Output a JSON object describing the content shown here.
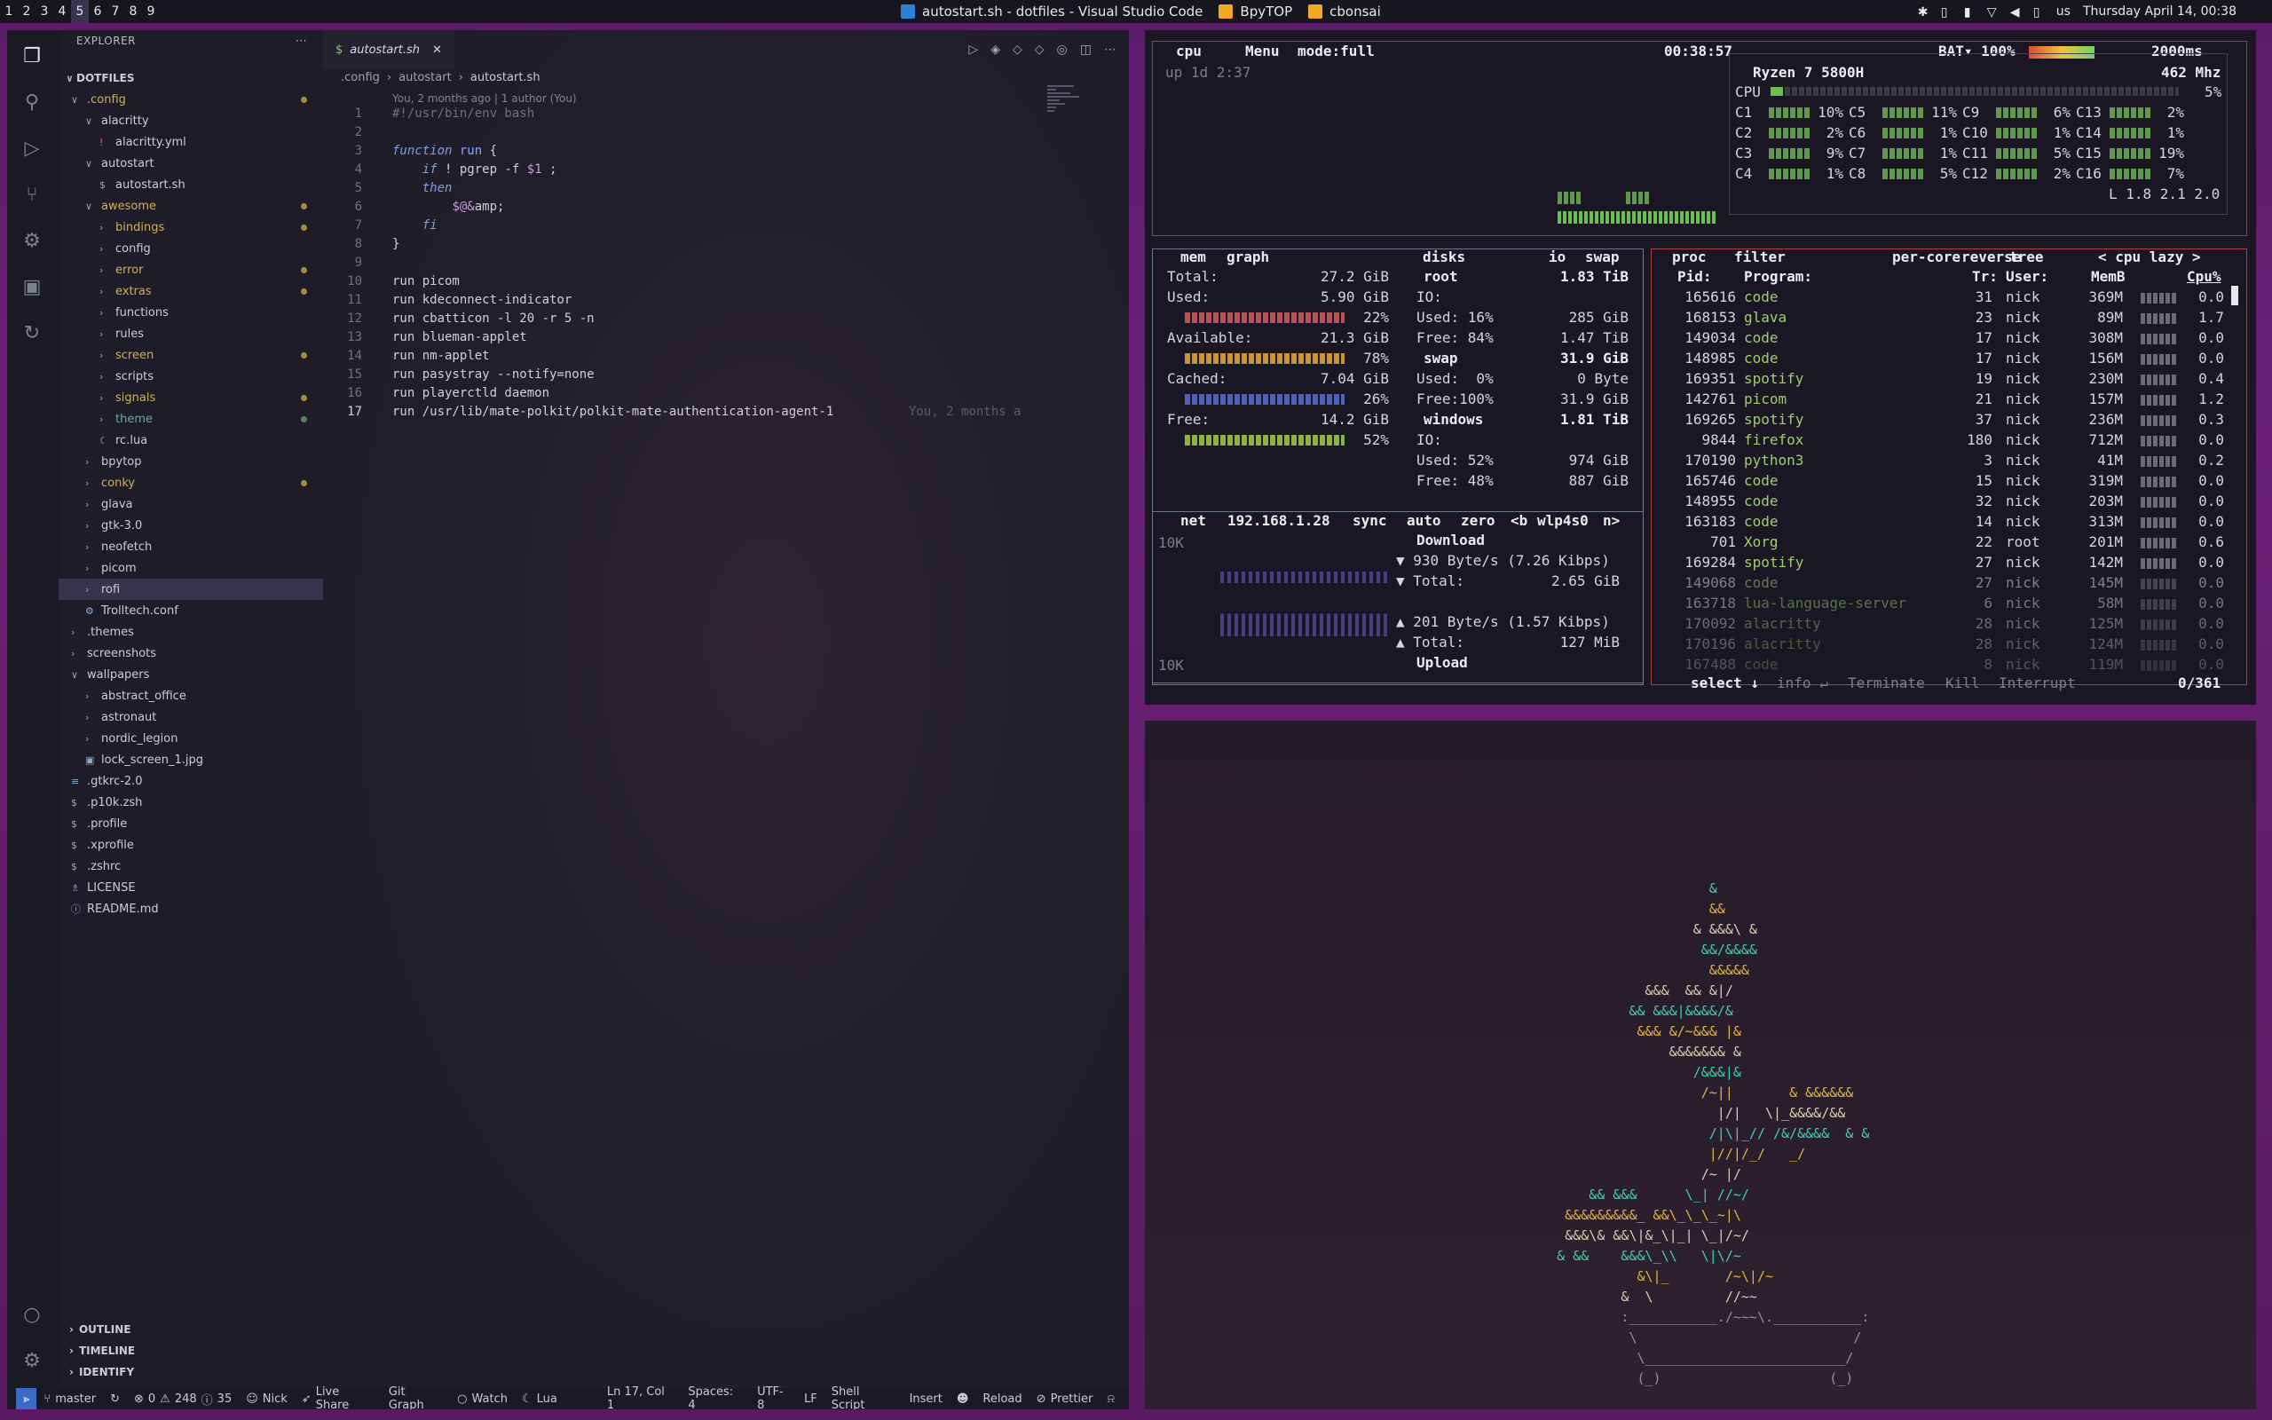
{
  "topbar": {
    "workspaces": [
      "1",
      "2",
      "3",
      "4",
      "5",
      "6",
      "7",
      "8",
      "9"
    ],
    "active_workspace": "5",
    "windows": [
      {
        "title": "autostart.sh - dotfiles - Visual Studio Code",
        "icon": "vscode-icon"
      },
      {
        "title": "BpyTOP",
        "icon": "terminal-icon"
      },
      {
        "title": "cbonsai",
        "icon": "terminal-icon"
      }
    ],
    "keyboard_layout": "us",
    "datetime": "Thursday April 14, 00:38"
  },
  "vscode": {
    "explorer_title": "EXPLORER",
    "more_actions": "···",
    "root": "DOTFILES",
    "tree": [
      {
        "label": ".config",
        "depth": 0,
        "type": "folder-open",
        "color": "#d5b04a",
        "dot": "yellow"
      },
      {
        "label": "alacritty",
        "depth": 1,
        "type": "folder-open",
        "color": "#c9cdd6"
      },
      {
        "label": "alacritty.yml",
        "depth": 2,
        "type": "file",
        "icon": "!",
        "color": "#c9cdd6"
      },
      {
        "label": "autostart",
        "depth": 1,
        "type": "folder-open",
        "color": "#c9cdd6"
      },
      {
        "label": "autostart.sh",
        "depth": 2,
        "type": "file",
        "icon": "$",
        "color": "#c9cdd6"
      },
      {
        "label": "awesome",
        "depth": 1,
        "type": "folder-open",
        "color": "#d5b04a",
        "dot": "yellow"
      },
      {
        "label": "bindings",
        "depth": 2,
        "type": "folder",
        "color": "#d5b04a",
        "dot": "yellow"
      },
      {
        "label": "config",
        "depth": 2,
        "type": "folder",
        "color": "#c9cdd6"
      },
      {
        "label": "error",
        "depth": 2,
        "type": "folder",
        "color": "#d5b04a",
        "dot": "yellow"
      },
      {
        "label": "extras",
        "depth": 2,
        "type": "folder",
        "color": "#d5b04a",
        "dot": "yellow"
      },
      {
        "label": "functions",
        "depth": 2,
        "type": "folder",
        "color": "#c9cdd6"
      },
      {
        "label": "rules",
        "depth": 2,
        "type": "folder",
        "color": "#c9cdd6"
      },
      {
        "label": "screen",
        "depth": 2,
        "type": "folder",
        "color": "#d5b04a",
        "dot": "yellow"
      },
      {
        "label": "scripts",
        "depth": 2,
        "type": "folder",
        "color": "#c9cdd6"
      },
      {
        "label": "signals",
        "depth": 2,
        "type": "folder",
        "color": "#d5b04a",
        "dot": "yellow"
      },
      {
        "label": "theme",
        "depth": 2,
        "type": "folder",
        "color": "#5eb2a0",
        "dot": "green"
      },
      {
        "label": "rc.lua",
        "depth": 2,
        "type": "file",
        "icon": "☾",
        "color": "#c9cdd6"
      },
      {
        "label": "bpytop",
        "depth": 1,
        "type": "folder",
        "color": "#c9cdd6"
      },
      {
        "label": "conky",
        "depth": 1,
        "type": "folder",
        "color": "#d5b04a",
        "dot": "yellow"
      },
      {
        "label": "glava",
        "depth": 1,
        "type": "folder",
        "color": "#c9cdd6"
      },
      {
        "label": "gtk-3.0",
        "depth": 1,
        "type": "folder",
        "color": "#c9cdd6"
      },
      {
        "label": "neofetch",
        "depth": 1,
        "type": "folder",
        "color": "#c9cdd6"
      },
      {
        "label": "picom",
        "depth": 1,
        "type": "folder",
        "color": "#c9cdd6"
      },
      {
        "label": "rofi",
        "depth": 1,
        "type": "folder",
        "color": "#c9cdd6",
        "selected": true
      },
      {
        "label": "Trolltech.conf",
        "depth": 1,
        "type": "file",
        "icon": "⚙",
        "color": "#c9cdd6"
      },
      {
        "label": ".themes",
        "depth": 0,
        "type": "folder",
        "color": "#c9cdd6"
      },
      {
        "label": "screenshots",
        "depth": 0,
        "type": "folder",
        "color": "#c9cdd6"
      },
      {
        "label": "wallpapers",
        "depth": 0,
        "type": "folder-open",
        "color": "#c9cdd6"
      },
      {
        "label": "abstract_office",
        "depth": 1,
        "type": "folder",
        "color": "#c9cdd6"
      },
      {
        "label": "astronaut",
        "depth": 1,
        "type": "folder",
        "color": "#c9cdd6"
      },
      {
        "label": "nordic_legion",
        "depth": 1,
        "type": "folder",
        "color": "#c9cdd6"
      },
      {
        "label": "lock_screen_1.jpg",
        "depth": 1,
        "type": "file",
        "icon": "▣",
        "color": "#c9cdd6"
      },
      {
        "label": ".gtkrc-2.0",
        "depth": 0,
        "type": "file",
        "icon": "≡",
        "color": "#c9cdd6"
      },
      {
        "label": ".p10k.zsh",
        "depth": 0,
        "type": "file",
        "icon": "$",
        "color": "#c9cdd6"
      },
      {
        "label": ".profile",
        "depth": 0,
        "type": "file",
        "icon": "$",
        "color": "#c9cdd6"
      },
      {
        "label": ".xprofile",
        "depth": 0,
        "type": "file",
        "icon": "$",
        "color": "#c9cdd6"
      },
      {
        "label": ".zshrc",
        "depth": 0,
        "type": "file",
        "icon": "$",
        "color": "#c9cdd6"
      },
      {
        "label": "LICENSE",
        "depth": 0,
        "type": "file",
        "icon": "♗",
        "color": "#c9cdd6"
      },
      {
        "label": "README.md",
        "depth": 0,
        "type": "file",
        "icon": "ⓘ",
        "color": "#c9cdd6"
      }
    ],
    "sections": [
      "OUTLINE",
      "TIMELINE",
      "IDENTIFY"
    ],
    "tab": {
      "label": "autostart.sh",
      "icon": "$"
    },
    "breadcrumb": [
      ".config",
      "autostart",
      "autostart.sh"
    ],
    "blame_header": "You, 2 months ago | 1 author (You)",
    "code": [
      "#!/usr/bin/env bash",
      "",
      "function run {",
      "    if ! pgrep -f $1 ;",
      "    then",
      "        $@&",
      "    fi",
      "}",
      "",
      "run picom",
      "run kdeconnect-indicator",
      "run cbatticon -l 20 -r 5 -n",
      "run blueman-applet",
      "run nm-applet",
      "run pasystray --notify=none",
      "run playerctld daemon",
      "run /usr/lib/mate-polkit/polkit-mate-authentication-agent-1"
    ],
    "inline_blame": "You, 2 months a",
    "current_line": 17,
    "status": {
      "branch": "master",
      "errors": "0",
      "warnings": "248",
      "info": "35",
      "user": "Nick",
      "live_share": "Live Share",
      "git_graph": "Git Graph",
      "watch": "Watch",
      "lua": "Lua",
      "position": "Ln 17, Col 1",
      "spaces": "Spaces: 4",
      "encoding": "UTF-8",
      "eol": "LF",
      "language": "Shell Script",
      "mode": "Insert",
      "reload": "Reload",
      "prettier": "Prettier"
    }
  },
  "bpytop": {
    "cpu_box": {
      "label": "cpu",
      "menu": "Menu",
      "mode": "mode:full",
      "clock": "00:38:57",
      "battery": "BAT▾ 100%",
      "interval": "2000ms",
      "uptime": "up 1d 2:37"
    },
    "cpu_info": {
      "model": "Ryzen 7 5800H",
      "freq": "462 Mhz",
      "total": "5%",
      "cores": [
        [
          "C1",
          "10%"
        ],
        [
          "C5",
          "11%"
        ],
        [
          "C9",
          "6%"
        ],
        [
          "C13",
          "2%"
        ],
        [
          "C2",
          "2%"
        ],
        [
          "C6",
          "1%"
        ],
        [
          "C10",
          "1%"
        ],
        [
          "C14",
          "1%"
        ],
        [
          "C3",
          "9%"
        ],
        [
          "C7",
          "1%"
        ],
        [
          "C11",
          "5%"
        ],
        [
          "C15",
          "19%"
        ],
        [
          "C4",
          "1%"
        ],
        [
          "C8",
          "5%"
        ],
        [
          "C12",
          "2%"
        ],
        [
          "C16",
          "7%"
        ]
      ],
      "load": "L 1.8 2.1 2.0"
    },
    "mem": {
      "tabs": [
        "mem",
        "graph"
      ],
      "rows": [
        [
          "Total:",
          "27.2 GiB"
        ],
        [
          "Used:",
          "5.90 GiB"
        ],
        [
          "",
          "22%"
        ],
        [
          "Available:",
          "21.3 GiB"
        ],
        [
          "",
          "78%"
        ],
        [
          "Cached:",
          "7.04 GiB"
        ],
        [
          "",
          "26%"
        ],
        [
          "Free:",
          "14.2 GiB"
        ],
        [
          "",
          "52%"
        ]
      ]
    },
    "disks": {
      "tabs": [
        "disks",
        "io",
        "swap"
      ],
      "rows": [
        [
          "root",
          "1.83 TiB",
          true
        ],
        [
          "IO:",
          "",
          false
        ],
        [
          "Used: 16%",
          "285 GiB",
          false
        ],
        [
          "Free: 84%",
          "1.47 TiB",
          false
        ],
        [
          "swap",
          "31.9 GiB",
          true
        ],
        [
          "Used:  0%",
          "0 Byte",
          false
        ],
        [
          "Free:100%",
          "31.9 GiB",
          false
        ],
        [
          "windows",
          "1.81 TiB",
          true
        ],
        [
          "IO:",
          "",
          false
        ],
        [
          "Used: 52%",
          "974 GiB",
          false
        ],
        [
          "Free: 48%",
          "887 GiB",
          false
        ]
      ]
    },
    "net": {
      "label": "net",
      "ip": "192.168.1.28",
      "opts": [
        "sync",
        "auto",
        "zero",
        "<b",
        "wlp4s0",
        "n>"
      ],
      "scale_top": "10K",
      "scale_bottom": "10K",
      "download": "Download",
      "down_rate": "▼ 930 Byte/s (7.26 Kibps)",
      "down_total": "▼ Total:",
      "down_total_val": "2.65 GiB",
      "up_rate": "▲ 201 Byte/s (1.57 Kibps)",
      "up_total": "▲ Total:",
      "up_total_val": "127 MiB",
      "upload": "Upload"
    },
    "proc": {
      "tabs": [
        "proc",
        "filter",
        "per-core",
        "reverse",
        "tree",
        "< cpu lazy >"
      ],
      "columns": [
        "Pid:",
        "Program:",
        "Tr:",
        "User:",
        "MemB",
        "Cpu%"
      ],
      "rows": [
        [
          "165616",
          "code",
          "31",
          "nick",
          "369M",
          "0.0"
        ],
        [
          "168153",
          "glava",
          "23",
          "nick",
          "89M",
          "1.7"
        ],
        [
          "149034",
          "code",
          "17",
          "nick",
          "308M",
          "0.0"
        ],
        [
          "148985",
          "code",
          "17",
          "nick",
          "156M",
          "0.0"
        ],
        [
          "169351",
          "spotify",
          "19",
          "nick",
          "230M",
          "0.4"
        ],
        [
          "142761",
          "picom",
          "21",
          "nick",
          "157M",
          "1.2"
        ],
        [
          "169265",
          "spotify",
          "37",
          "nick",
          "236M",
          "0.3"
        ],
        [
          "9844",
          "firefox",
          "180",
          "nick",
          "712M",
          "0.0"
        ],
        [
          "170190",
          "python3",
          "3",
          "nick",
          "41M",
          "0.2"
        ],
        [
          "165746",
          "code",
          "15",
          "nick",
          "319M",
          "0.0"
        ],
        [
          "148955",
          "code",
          "32",
          "nick",
          "203M",
          "0.0"
        ],
        [
          "163183",
          "code",
          "14",
          "nick",
          "313M",
          "0.0"
        ],
        [
          "701",
          "Xorg",
          "22",
          "root",
          "201M",
          "0.6"
        ],
        [
          "169284",
          "spotify",
          "27",
          "nick",
          "142M",
          "0.0"
        ],
        [
          "149068",
          "code",
          "27",
          "nick",
          "145M",
          "0.0"
        ],
        [
          "163718",
          "lua-language-server",
          "6",
          "nick",
          "58M",
          "0.0"
        ],
        [
          "170092",
          "alacritty",
          "28",
          "nick",
          "125M",
          "0.0"
        ],
        [
          "170196",
          "alacritty",
          "28",
          "nick",
          "124M",
          "0.0"
        ],
        [
          "167488",
          "code",
          "8",
          "nick",
          "119M",
          "0.0"
        ]
      ],
      "footer": [
        "select ↓",
        "info ↵",
        "Terminate",
        "Kill",
        "Interrupt"
      ],
      "count": "0/361"
    }
  },
  "cbonsai": {
    "lines": [
      "                         &",
      "                         &&",
      "                       & &&&\\ &",
      "                        &&/&&&&",
      "                         &&&&&",
      "                 &&&  && &|/",
      "               && &&&|&&&&/&",
      "                &&& &/~&&& |&",
      "                    &&&&&&& &",
      "                       /&&&|&",
      "                        /~||       & &&&&&&",
      "                          |/|   \\|_&&&&/&&",
      "                         /|\\|_// /&/&&&&  & &",
      "                         |//|/_/   _/",
      "                        /~ |/",
      "          && &&&      \\_| //~/",
      "       &&&&&&&&&_ &&\\_\\_\\_~|\\",
      "       &&&\\& &&\\|&_\\|_| \\_|/~/",
      "      & &&    &&&\\_\\\\   \\|\\/~",
      "                &\\|_       /~\\|/~",
      "              &  \\         //~~",
      "              :___________./~~~\\.___________:",
      "               \\                           /",
      "                \\_________________________/",
      "                (_)                     (_)"
    ]
  }
}
